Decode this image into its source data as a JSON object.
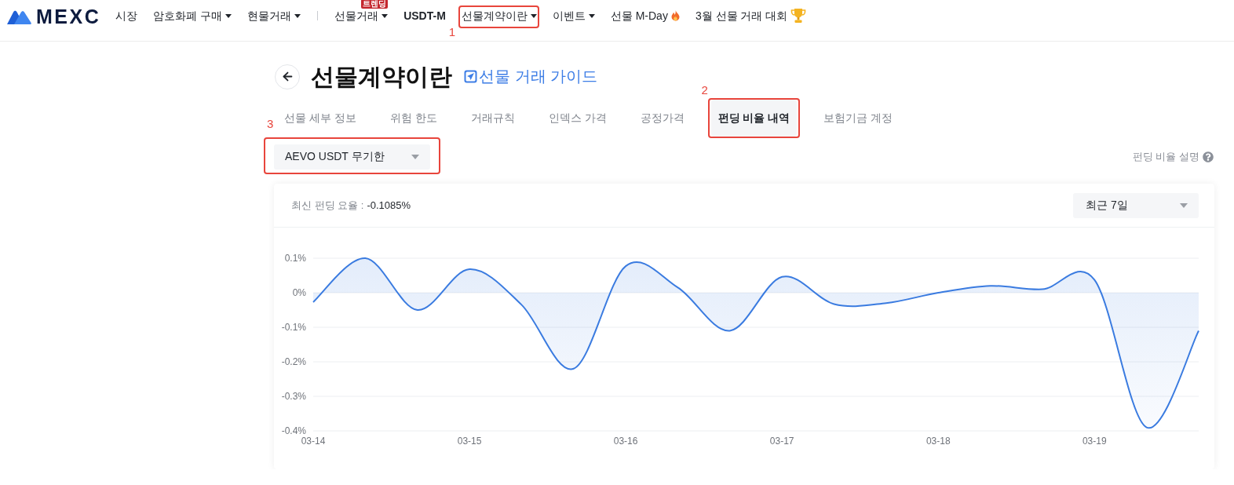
{
  "nav": {
    "logo": "MEXC",
    "items": [
      {
        "kind": "link",
        "label": "시장"
      },
      {
        "kind": "menu",
        "label": "암호화폐 구매"
      },
      {
        "kind": "menu",
        "label": "현물거래"
      },
      {
        "kind": "divider"
      },
      {
        "kind": "menu",
        "label": "선물거래",
        "badge": "트렌딩"
      },
      {
        "kind": "featured",
        "label": "USDT-M"
      },
      {
        "kind": "menu",
        "label": "선물계약이란",
        "callout": "1"
      },
      {
        "kind": "menu",
        "label": "이벤트"
      },
      {
        "kind": "hot",
        "label": "선물 M-Day"
      },
      {
        "kind": "contest",
        "label": "3월 선물 거래 대회"
      }
    ]
  },
  "page": {
    "title": "선물계약이란",
    "guide_link": "선물 거래 가이드"
  },
  "tabs": [
    {
      "label": "선물 세부 정보",
      "selected": false
    },
    {
      "label": "위험 한도",
      "selected": false
    },
    {
      "label": "거래규칙",
      "selected": false
    },
    {
      "label": "인덱스 가격",
      "selected": false
    },
    {
      "label": "공정가격",
      "selected": false
    },
    {
      "label": "펀딩 비율 내역",
      "selected": true,
      "callout": "2"
    },
    {
      "label": "보험기금 계정",
      "selected": false
    }
  ],
  "contract_select": {
    "value": "AEVO USDT 무기한",
    "callout": "3"
  },
  "help_link": "펀딩 비율 설명",
  "rate_card": {
    "latest_label": "최신 펀딩 요율 :",
    "latest_value": "-0.1085%",
    "period_select": "최근 7일",
    "chart_data": {
      "type": "area",
      "grid": true,
      "categories": [
        "03-14",
        null,
        null,
        "03-15",
        null,
        null,
        "03-16",
        null,
        null,
        "03-17",
        null,
        null,
        "03-18",
        null,
        null,
        "03-19",
        null,
        null
      ],
      "series": [
        {
          "color": "#3a7be0",
          "values": [
            -0.027,
            0.1,
            -0.05,
            0.068,
            -0.035,
            -0.22,
            0.077,
            0.015,
            -0.11,
            0.046,
            -0.033,
            -0.03,
            0.0,
            0.02,
            0.01,
            0.037,
            -0.39,
            -0.11
          ]
        }
      ],
      "ylim": [
        -0.4,
        0.1
      ],
      "yticks": [
        {
          "value": 0.1,
          "label": "0.1%"
        },
        {
          "value": 0,
          "label": "0%"
        },
        {
          "value": -0.1,
          "label": "-0.1%"
        },
        {
          "value": -0.2,
          "label": "-0.2%"
        },
        {
          "value": -0.3,
          "label": "-0.3%"
        },
        {
          "value": -0.4,
          "label": "-0.4%"
        }
      ]
    }
  }
}
